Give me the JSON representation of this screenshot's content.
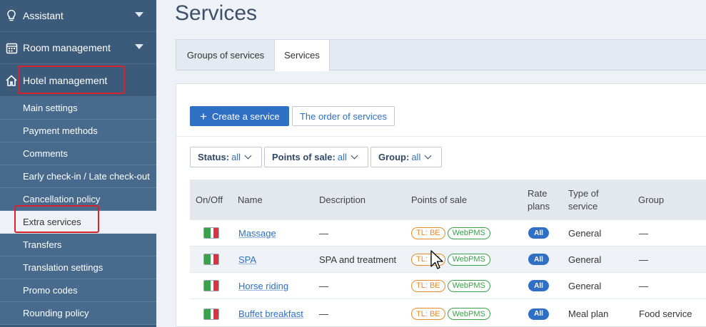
{
  "sidebar": {
    "top_items": [
      {
        "label": "Assistant",
        "icon": "lightbulb-icon"
      },
      {
        "label": "Room management",
        "icon": "calendar-icon"
      },
      {
        "label": "Hotel management",
        "icon": "home-icon"
      }
    ],
    "sub_items": [
      {
        "label": "Main settings"
      },
      {
        "label": "Payment methods"
      },
      {
        "label": "Comments"
      },
      {
        "label": "Early check-in / Late check-out"
      },
      {
        "label": "Cancellation policy"
      },
      {
        "label": "Extra services"
      },
      {
        "label": "Transfers"
      },
      {
        "label": "Translation settings"
      },
      {
        "label": "Promo codes"
      },
      {
        "label": "Rounding policy"
      }
    ]
  },
  "main": {
    "title": "Services",
    "tabs": [
      {
        "label": "Groups of services"
      },
      {
        "label": "Services"
      }
    ],
    "create_button": "Create a service",
    "order_button": "The order of services",
    "filters": [
      {
        "label": "Status:",
        "value": "all"
      },
      {
        "label": "Points of sale:",
        "value": "all"
      },
      {
        "label": "Group:",
        "value": "all"
      }
    ],
    "table": {
      "headers": {
        "onoff": "On/Off",
        "name": "Name",
        "description": "Description",
        "pos": "Points of sale",
        "rate_plans_1": "Rate",
        "rate_plans_2": "plans",
        "type_1": "Type of",
        "type_2": "service",
        "group": "Group"
      },
      "rows": [
        {
          "name": "Massage",
          "description": "—",
          "pos_1": "TL: BE",
          "pos_2": "WebPMS",
          "rate": "All",
          "type": "General",
          "group": "—"
        },
        {
          "name": "SPA",
          "description": "SPA and treatment",
          "pos_1": "TL: BE",
          "pos_2": "WebPMS",
          "rate": "All",
          "type": "General",
          "group": "—"
        },
        {
          "name": "Horse riding",
          "description": "—",
          "pos_1": "TL: BE",
          "pos_2": "WebPMS",
          "rate": "All",
          "type": "General",
          "group": "—"
        },
        {
          "name": "Buffet breakfast",
          "description": "—",
          "pos_1": "TL: BE",
          "pos_2": "WebPMS",
          "rate": "All",
          "type": "Meal plan",
          "group": "Food service"
        }
      ]
    }
  },
  "colors": {
    "sidebar_bg": "#3c5a7a",
    "sidebar_sub_bg": "#486a8d",
    "primary": "#2f6fc4",
    "highlight_box": "#d9232d",
    "tag_orange": "#e38a2a",
    "tag_green": "#3aa14a"
  }
}
